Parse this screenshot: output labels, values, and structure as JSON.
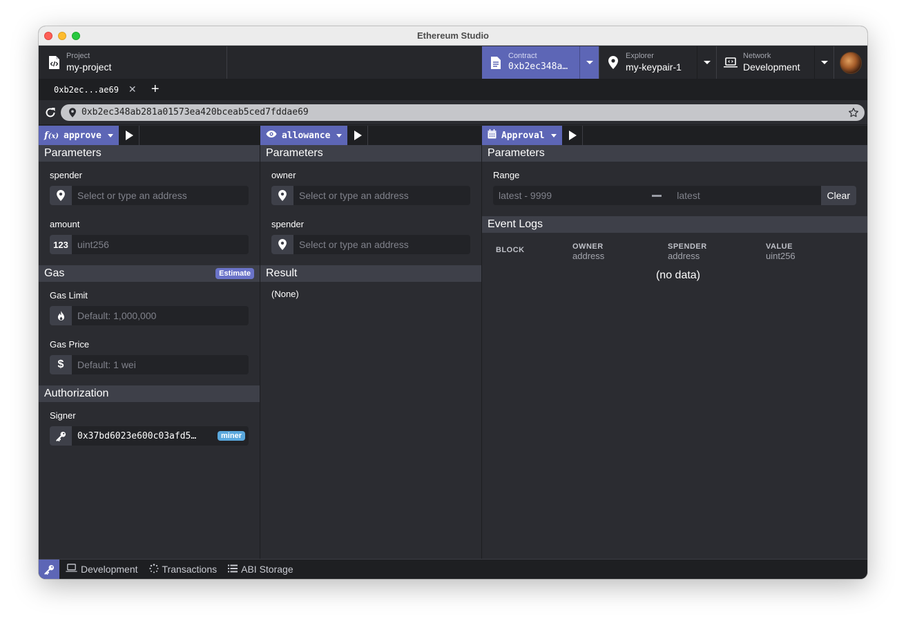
{
  "window": {
    "title": "Ethereum Studio"
  },
  "header": {
    "project": {
      "label": "Project",
      "value": "my-project"
    },
    "contract": {
      "label": "Contract",
      "value": "0xb2ec348a…"
    },
    "explorer": {
      "label": "Explorer",
      "value": "my-keypair-1"
    },
    "network": {
      "label": "Network",
      "value": "Development"
    }
  },
  "tabs": [
    {
      "label": "0xb2ec...ae69"
    }
  ],
  "url": {
    "value": "0xb2ec348ab281a01573ea420bceab5ced7fddae69"
  },
  "panels": {
    "approve": {
      "fn_label": "approve",
      "params_title": "Parameters",
      "params": [
        {
          "label": "spender",
          "placeholder": "Select or type an address"
        },
        {
          "label": "amount",
          "icon_text": "123",
          "placeholder": "uint256"
        }
      ],
      "gas": {
        "title": "Gas",
        "estimate_label": "Estimate",
        "limit_label": "Gas Limit",
        "limit_placeholder": "Default: 1,000,000",
        "price_label": "Gas Price",
        "price_icon": "$",
        "price_placeholder": "Default: 1 wei"
      },
      "auth": {
        "title": "Authorization",
        "signer_label": "Signer",
        "signer_value": "0x37bd6023e600c03afd5…",
        "signer_badge": "miner"
      }
    },
    "allowance": {
      "fn_label": "allowance",
      "params_title": "Parameters",
      "params": [
        {
          "label": "owner",
          "placeholder": "Select or type an address"
        },
        {
          "label": "spender",
          "placeholder": "Select or type an address"
        }
      ],
      "result_title": "Result",
      "result_value": "(None)"
    },
    "approval": {
      "fn_label": "Approval",
      "params_title": "Parameters",
      "range_label": "Range",
      "range_from": "latest - 9999",
      "range_to": "latest",
      "clear_label": "Clear",
      "logs_title": "Event Logs",
      "columns": [
        {
          "name": "BLOCK",
          "type": ""
        },
        {
          "name": "OWNER",
          "type": "address"
        },
        {
          "name": "SPENDER",
          "type": "address"
        },
        {
          "name": "VALUE",
          "type": "uint256"
        }
      ],
      "no_data": "(no data)"
    }
  },
  "bottombar": {
    "items": [
      {
        "label": "Development"
      },
      {
        "label": "Transactions"
      },
      {
        "label": "ABI Storage"
      }
    ]
  },
  "colors": {
    "accent": "#5d66b6",
    "badge_miner": "#5aa8dd",
    "panel_bg": "#2b2c31"
  }
}
